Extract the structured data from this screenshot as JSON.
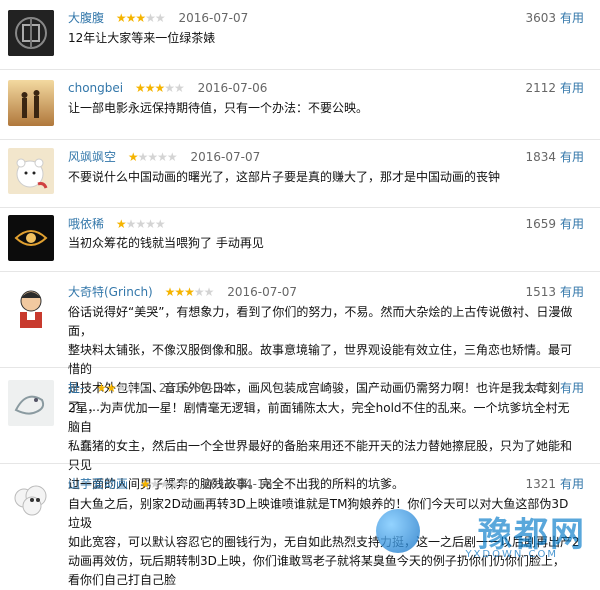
{
  "reviews": [
    {
      "user": "大腹腹",
      "rating": 3,
      "date": "2016-07-07",
      "useful_count": "3603",
      "useful_label": "有用",
      "text": "12年让大家等来一位绿茶婊",
      "avatar": "dark-emblem-avatar"
    },
    {
      "user": "chongbei",
      "rating": 3,
      "date": "2016-07-06",
      "useful_count": "2112",
      "useful_label": "有用",
      "text": "让一部电影永远保持期待值，只有一个办法：不要公映。",
      "avatar": "sunset-couple-avatar"
    },
    {
      "user": "风飒飒空",
      "rating": 1,
      "date": "2016-07-07",
      "useful_count": "1834",
      "useful_label": "有用",
      "text": "不要说什么中国动画的曙光了，这部片子要是真的赚大了，那才是中国动画的丧钟",
      "avatar": "white-bear-avatar"
    },
    {
      "user": "哦依稀",
      "rating": 1,
      "date": "",
      "useful_count": "1659",
      "useful_label": "有用",
      "text": "当初众筹花的钱就当喂狗了 手动再见",
      "avatar": "glowing-symbol-avatar"
    },
    {
      "user": "大奇特(Grinch)",
      "rating": 3,
      "date": "2016-07-07",
      "useful_count": "1513",
      "useful_label": "有用",
      "text_lines": [
        "俗话说得好“美哭”，有想象力，看到了你们的努力，不易。然而大杂烩的上古传说傲衬、日漫做面，",
        "整块料太铺张，不像汉服倒像和服。故事意境输了，世界观设能有效立住，三角恋也矫情。最可惜的",
        "是技术外包韩国、音乐外包日本，画风包装成宫崎骏，国产动画仍需努力啊！也许是我太苛刻了……"
      ],
      "avatar": "cartoon-man-avatar"
    },
    {
      "user": "扯-",
      "rating": 2,
      "date": "2016-07-04",
      "useful_count": "1417",
      "useful_label": "有用",
      "text_lines": [
        "2星，为声优加一星！剧情毫无逻辑，前面铺陈太大，完全hold不住的乱来。一个坑爹坑全村无脑自",
        "私蠢猪的女主，然后由一个全世界最好的备胎来用还不能开天的法力替她擦屁股，只为了她能和只见",
        "过一面的人间男子裸奔的脑残故事。完全不出我的所料的坑爹。"
      ],
      "avatar": "sketch-bird-avatar"
    },
    {
      "user": "山芋爱动画",
      "rating": 1,
      "date": "2016-04-18",
      "useful_count": "1321",
      "useful_label": "有用",
      "text_lines": [
        "自大鱼之后，别家2D动画再转3D上映谁喷谁就是TM狗娘养的！你们今天可以对大鱼这部伪3D垃圾",
        "如此宽容，可以默认容忍它的圈钱行为，无自如此热烈支持力挺，这一之后剧一一以后剧再出产2",
        "动画再效仿，玩后期转制3D上映，你们谁敢骂老子就将某臭鱼今天的例子扔你们仍你们脸上，",
        "看你们自己打自己脸"
      ],
      "avatar": "sheep-cartoon-avatar"
    }
  ],
  "watermark": {
    "brand": "豫都网",
    "url": "YXDOWN.COM"
  },
  "colors": {
    "link": "#3377aa",
    "star_on": "#f5b400",
    "star_off": "#d4d4d4"
  }
}
